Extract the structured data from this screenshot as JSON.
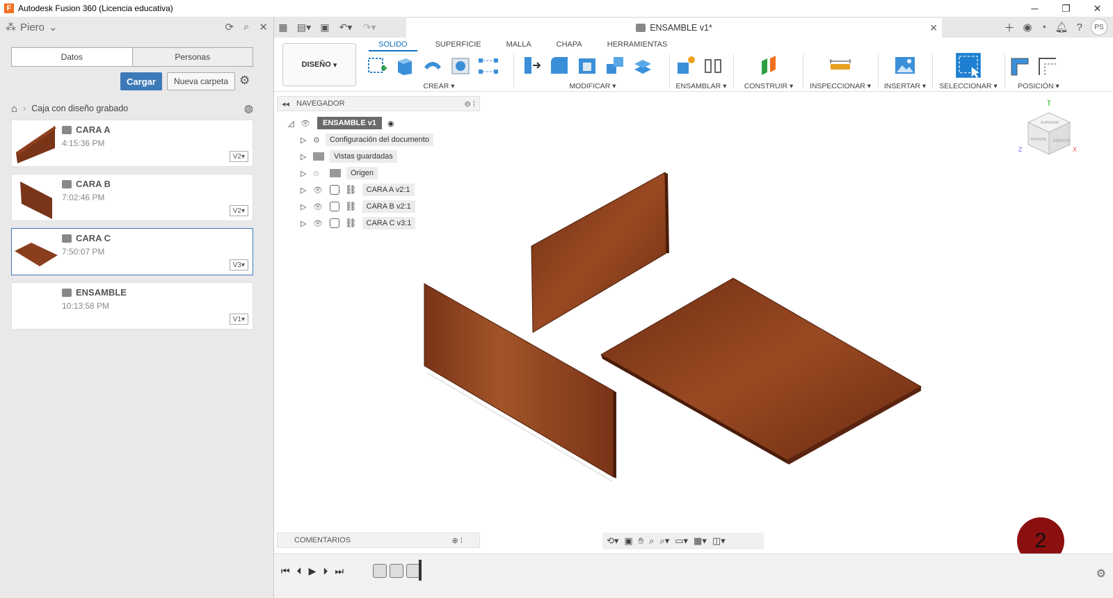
{
  "window": {
    "title": "Autodesk Fusion 360 (Licencia educativa)",
    "logo_letter": "F"
  },
  "data_panel": {
    "user": "Piero",
    "tabs": [
      "Datos",
      "Personas"
    ],
    "upload_label": "Cargar",
    "new_folder_label": "Nueva carpeta",
    "breadcrumb": "Caja con diseño grabado",
    "files": [
      {
        "name": "CARA A",
        "time": "4:15:36 PM",
        "version": "V2"
      },
      {
        "name": "CARA B",
        "time": "7:02:46 PM",
        "version": "V2"
      },
      {
        "name": "CARA C",
        "time": "7:50:07 PM",
        "version": "V3"
      },
      {
        "name": "ENSAMBLE",
        "time": "10:13:58 PM",
        "version": "V1"
      }
    ]
  },
  "document_tab": {
    "title": "ENSAMBLE v1*",
    "user_initials": "PS"
  },
  "ribbon": {
    "workspace": "DISEÑO",
    "tabs": [
      "SOLIDO",
      "SUPERFICIE",
      "MALLA",
      "CHAPA",
      "HERRAMIENTAS"
    ],
    "active_tab": "SOLIDO",
    "groups": [
      "CREAR",
      "MODIFICAR",
      "ENSAMBLAR",
      "CONSTRUIR",
      "INSPECCIONAR",
      "INSERTAR",
      "SELECCIONAR",
      "POSICIÓN"
    ]
  },
  "browser": {
    "title": "NAVEGADOR",
    "root": "ENSAMBLE v1",
    "items": [
      {
        "label": "Configuración del documento"
      },
      {
        "label": "Vistas guardadas"
      },
      {
        "label": "Origen"
      },
      {
        "label": "CARA A v2:1"
      },
      {
        "label": "CARA B v2:1"
      },
      {
        "label": "CARA C v3:1"
      }
    ]
  },
  "comments": {
    "label": "COMENTARIOS"
  },
  "viewcube": {
    "front": "FRONTAL",
    "right": "DERECHA",
    "top": "SUPERIOR",
    "axes": [
      "Y",
      "Z",
      "X"
    ]
  },
  "badge": {
    "number": "2"
  },
  "colors": {
    "accent": "#0a6ebd",
    "upload": "#3d7ab8",
    "wood": "#8a3e1e",
    "badge": "#8b0f0f"
  }
}
